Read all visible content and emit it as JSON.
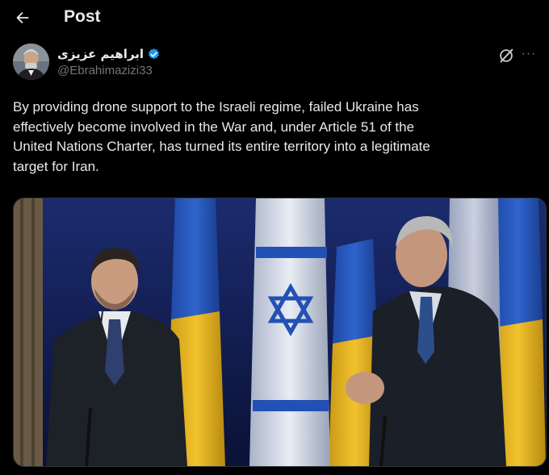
{
  "header": {
    "title": "Post",
    "back_icon": "arrow-left-icon"
  },
  "author": {
    "display_name": "ابراهیم عزیزی",
    "handle": "@Ebrahimazizi33",
    "verified_color": "#1d9bf0"
  },
  "actions": {
    "grok_icon": "grok-icon",
    "more_icon": "more-horizontal-icon",
    "more_label": "···"
  },
  "post": {
    "text": "By providing drone support to the Israeli regime, failed Ukraine has\neffectively become involved in the War and, under Article 51 of the\nUnited Nations Charter, has turned its entire territory into a legitimate\ntarget for Iran."
  },
  "media": {
    "type": "photo"
  },
  "colors": {
    "background": "#000000",
    "text": "#e7e9ea",
    "muted": "#71767b",
    "accent": "#1d9bf0"
  }
}
